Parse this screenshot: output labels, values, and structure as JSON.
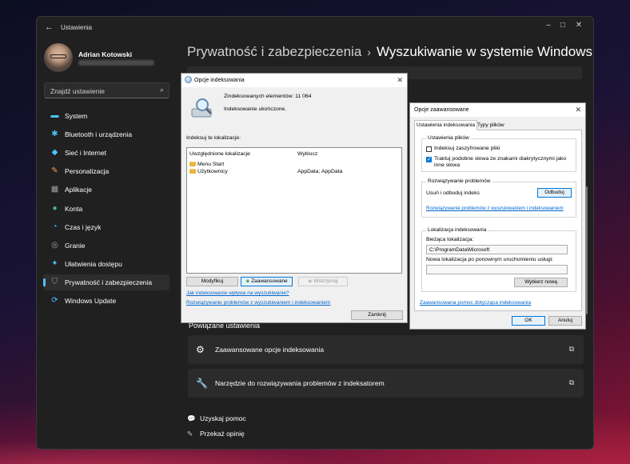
{
  "settings": {
    "app_title": "Ustawienia",
    "profile": {
      "name": "Adrian Kotowski"
    },
    "search_placeholder": "Znajdź ustawienie",
    "nav": [
      {
        "label": "System",
        "icon": "monitor-icon",
        "color": "#4cc2ff"
      },
      {
        "label": "Bluetooth i urządzenia",
        "icon": "bluetooth-icon",
        "color": "#4cc2ff"
      },
      {
        "label": "Sieć i Internet",
        "icon": "wifi-icon",
        "color": "#4cc2ff"
      },
      {
        "label": "Personalizacja",
        "icon": "brush-icon",
        "color": "#f7a14a"
      },
      {
        "label": "Aplikacje",
        "icon": "apps-icon",
        "color": "#a0a0a0"
      },
      {
        "label": "Konta",
        "icon": "account-icon",
        "color": "#3ec07a"
      },
      {
        "label": "Czas i język",
        "icon": "globe-clock-icon",
        "color": "#4cc2ff"
      },
      {
        "label": "Granie",
        "icon": "gamepad-icon",
        "color": "#a0a0a0"
      },
      {
        "label": "Ułatwienia dostępu",
        "icon": "accessibility-icon",
        "color": "#4cc2ff"
      },
      {
        "label": "Prywatność i zabezpieczenia",
        "icon": "shield-icon",
        "color": "#a0a0a0",
        "active": true
      },
      {
        "label": "Windows Update",
        "icon": "update-icon",
        "color": "#4cc2ff"
      }
    ],
    "breadcrumb": {
      "parent": "Prywatność i zabezpieczenia",
      "separator": "›",
      "current": "Wyszukiwanie w systemie Windows"
    },
    "related_title": "Powiązane ustawienia",
    "related": [
      {
        "label": "Zaawansowane opcje indeksowania",
        "icon": "gear-icon"
      },
      {
        "label": "Narzędzie do rozwiązywania problemów z indeksatorem",
        "icon": "wrench-icon"
      }
    ],
    "help": [
      {
        "label": "Uzyskaj pomoc",
        "icon": "help-chat-icon"
      },
      {
        "label": "Przekaż opinię",
        "icon": "feedback-icon"
      }
    ]
  },
  "indexing_dialog": {
    "title": "Opcje indeksowania",
    "indexed_count": "Zindeksowanych elementów: 11 064",
    "status": "Indeksowanie ukończone.",
    "locations_label": "Indeksuj te lokalizacje:",
    "columns": [
      "Uwzględnione lokalizacje",
      "Wyklucz"
    ],
    "rows": [
      {
        "location": "Menu Start",
        "exclude": ""
      },
      {
        "location": "Użytkownicy",
        "exclude": "AppData; AppData"
      }
    ],
    "buttons": {
      "modify": "Modyfikuj",
      "advanced": "Zaawansowane",
      "pause": "Wstrzymaj",
      "close": "Zamknij"
    },
    "links": [
      "Jak indeksowanie wpływa na wyszukiwanie?",
      "Rozwiązywanie problemów z wyszukiwaniem i indeksowaniem"
    ]
  },
  "advanced_dialog": {
    "title": "Opcje zaawansowane",
    "tabs": [
      "Ustawienia indeksowania",
      "Typy plików"
    ],
    "file_settings": {
      "label": "Ustawienia plików",
      "options": [
        {
          "label": "Indeksuj zaszyfrowane pliki",
          "checked": false
        },
        {
          "label": "Traktuj podobne słowa ze znakami diakrytycznymi jako inne słowa",
          "checked": true
        }
      ]
    },
    "troubleshoot": {
      "label": "Rozwiązywanie problemów",
      "rebuild_text": "Usuń i odbuduj indeks",
      "rebuild_button": "Odbuduj",
      "link": "Rozwiązywanie problemów z wyszukiwaniem i indeksowaniem"
    },
    "index_location": {
      "label": "Lokalizacja indeksowania",
      "current_label": "Bieżąca lokalizacja:",
      "current_value": "C:\\ProgramData\\Microsoft",
      "new_label": "Nowa lokalizacja po ponownym uruchomieniu usługi:",
      "new_value": "",
      "select_button": "Wybierz nową"
    },
    "help_link": "Zaawansowana pomoc dotycząca indeksowania",
    "ok": "OK",
    "cancel": "Anuluj"
  }
}
